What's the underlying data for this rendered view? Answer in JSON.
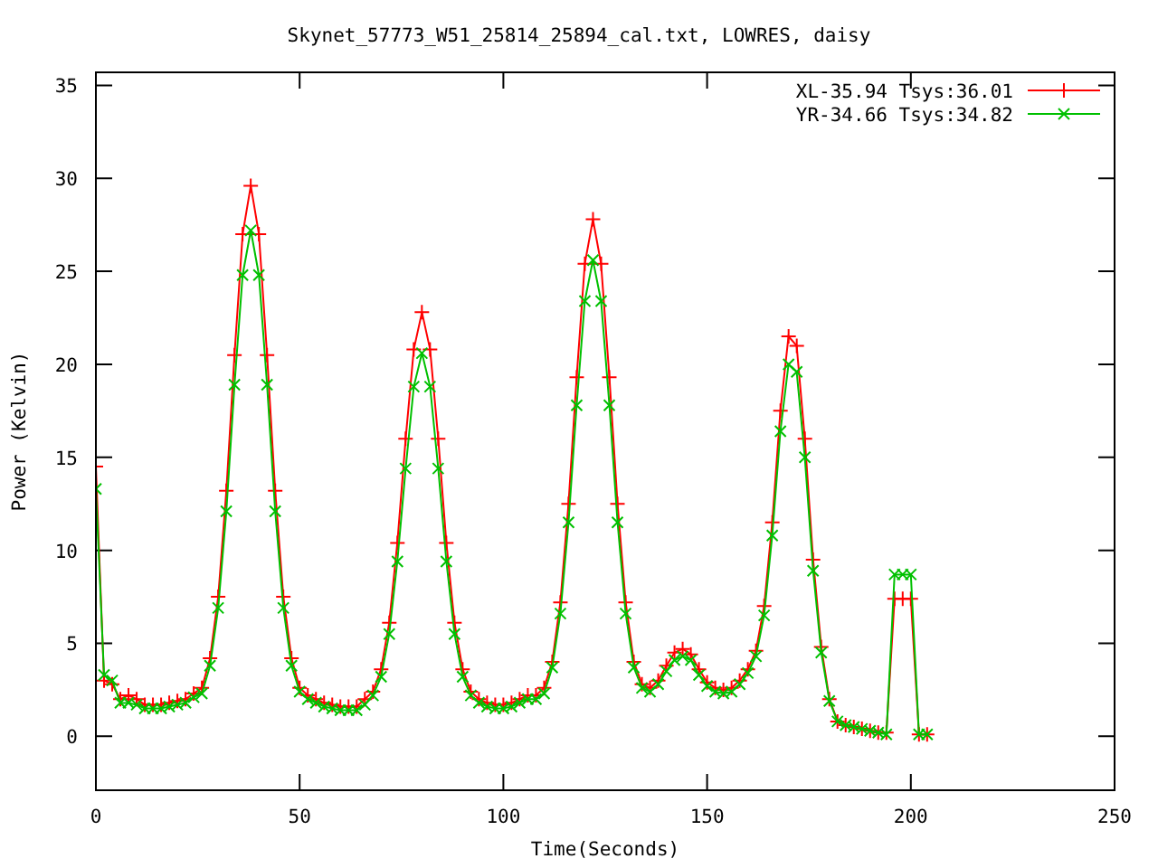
{
  "chart_data": {
    "type": "line",
    "legend": "top-right",
    "title": "Skynet_57773_W51_25814_25894_cal.txt, LOWRES, daisy",
    "xlabel": "Time(Seconds)",
    "ylabel": "Power (Kelvin)",
    "x": [
      0,
      2,
      4,
      6,
      8,
      10,
      12,
      14,
      16,
      18,
      20,
      22,
      24,
      26,
      28,
      30,
      32,
      34,
      36,
      38,
      40,
      42,
      44,
      46,
      48,
      50,
      52,
      54,
      56,
      58,
      60,
      62,
      64,
      66,
      68,
      70,
      72,
      74,
      76,
      78,
      80,
      82,
      84,
      86,
      88,
      90,
      92,
      94,
      96,
      98,
      100,
      102,
      104,
      106,
      108,
      110,
      112,
      114,
      116,
      118,
      120,
      122,
      124,
      126,
      128,
      130,
      132,
      134,
      136,
      138,
      140,
      142,
      144,
      146,
      148,
      150,
      152,
      154,
      156,
      158,
      160,
      162,
      164,
      166,
      168,
      170,
      172,
      174,
      176,
      178,
      180,
      182,
      184,
      186,
      188,
      190,
      192,
      194,
      196,
      198,
      200,
      202,
      204
    ],
    "series": [
      {
        "name": "XL-35.94 Tsys:36.01",
        "color": "#ff0000",
        "marker": "plus",
        "values": [
          14.5,
          3.0,
          2.8,
          2.0,
          2.2,
          2.0,
          1.7,
          1.7,
          1.7,
          1.8,
          1.9,
          2.0,
          2.3,
          2.6,
          4.2,
          7.5,
          13.2,
          20.5,
          27.0,
          29.6,
          27.0,
          20.5,
          13.2,
          7.5,
          4.2,
          2.6,
          2.2,
          2.0,
          1.8,
          1.7,
          1.6,
          1.6,
          1.6,
          2.0,
          2.4,
          3.6,
          6.1,
          10.4,
          16.0,
          20.8,
          22.8,
          20.8,
          16.0,
          10.4,
          6.1,
          3.6,
          2.4,
          2.0,
          1.8,
          1.7,
          1.7,
          1.8,
          2.0,
          2.2,
          2.2,
          2.6,
          4.0,
          7.2,
          12.5,
          19.3,
          25.4,
          27.8,
          25.4,
          19.3,
          12.5,
          7.2,
          4.0,
          2.8,
          2.6,
          3.0,
          3.8,
          4.5,
          4.7,
          4.4,
          3.6,
          2.9,
          2.6,
          2.5,
          2.6,
          3.0,
          3.6,
          4.6,
          7.0,
          11.5,
          17.5,
          21.5,
          21.0,
          16.0,
          9.5,
          4.8,
          2.0,
          0.8,
          0.6,
          0.5,
          0.4,
          0.3,
          0.2,
          0.2,
          7.4,
          7.4,
          7.4,
          0.1,
          0.1
        ]
      },
      {
        "name": "YR-34.66 Tsys:34.82",
        "color": "#00c000",
        "marker": "cross",
        "values": [
          13.3,
          3.3,
          3.0,
          1.8,
          1.8,
          1.7,
          1.5,
          1.5,
          1.5,
          1.6,
          1.7,
          1.8,
          2.1,
          2.3,
          3.8,
          6.9,
          12.1,
          18.9,
          24.8,
          27.2,
          24.8,
          18.9,
          12.1,
          6.9,
          3.8,
          2.4,
          2.0,
          1.8,
          1.6,
          1.5,
          1.4,
          1.4,
          1.4,
          1.7,
          2.2,
          3.2,
          5.5,
          9.4,
          14.4,
          18.8,
          20.6,
          18.8,
          14.4,
          9.4,
          5.5,
          3.2,
          2.2,
          1.8,
          1.6,
          1.5,
          1.5,
          1.6,
          1.8,
          2.0,
          2.0,
          2.3,
          3.7,
          6.6,
          11.5,
          17.8,
          23.4,
          25.6,
          23.4,
          17.8,
          11.5,
          6.6,
          3.7,
          2.6,
          2.4,
          2.8,
          3.5,
          4.1,
          4.3,
          4.1,
          3.3,
          2.7,
          2.4,
          2.3,
          2.4,
          2.8,
          3.4,
          4.3,
          6.5,
          10.8,
          16.4,
          20.0,
          19.6,
          15.0,
          8.9,
          4.5,
          1.9,
          0.8,
          0.6,
          0.5,
          0.4,
          0.3,
          0.2,
          0.1,
          8.7,
          8.7,
          8.7,
          0.1,
          0.1
        ]
      }
    ],
    "xlim": [
      0,
      250
    ],
    "ylim": [
      -2.9,
      35.7
    ],
    "xticks": [
      0,
      50,
      100,
      150,
      200,
      250
    ],
    "yticks": [
      0,
      5,
      10,
      15,
      20,
      25,
      30,
      35
    ]
  }
}
